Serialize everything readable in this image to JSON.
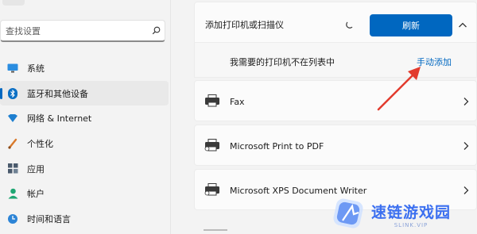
{
  "sidebar": {
    "search_placeholder": "查找设置",
    "items": [
      {
        "label": "系统",
        "icon": "monitor-icon"
      },
      {
        "label": "蓝牙和其他设备",
        "icon": "bluetooth-icon",
        "active": true
      },
      {
        "label": "网络 & Internet",
        "icon": "wifi-diamond-icon"
      },
      {
        "label": "个性化",
        "icon": "brush-icon"
      },
      {
        "label": "应用",
        "icon": "apps-icon"
      },
      {
        "label": "帐户",
        "icon": "person-icon"
      },
      {
        "label": "时间和语言",
        "icon": "globe-clock-icon"
      }
    ]
  },
  "main": {
    "add_header": {
      "title": "添加打印机或扫描仪",
      "refresh_label": "刷新"
    },
    "not_listed": {
      "message": "我需要的打印机不在列表中",
      "link": "手动添加"
    },
    "printers": [
      {
        "name": "Fax"
      },
      {
        "name": "Microsoft Print to PDF"
      },
      {
        "name": "Microsoft XPS Document Writer"
      }
    ]
  },
  "watermark": {
    "text": "速链游戏园",
    "sub": "SLINK.VIP"
  },
  "colors": {
    "accent": "#0067c0",
    "annotation_arrow": "#e23b2e",
    "watermark": "#3b6ff0"
  }
}
